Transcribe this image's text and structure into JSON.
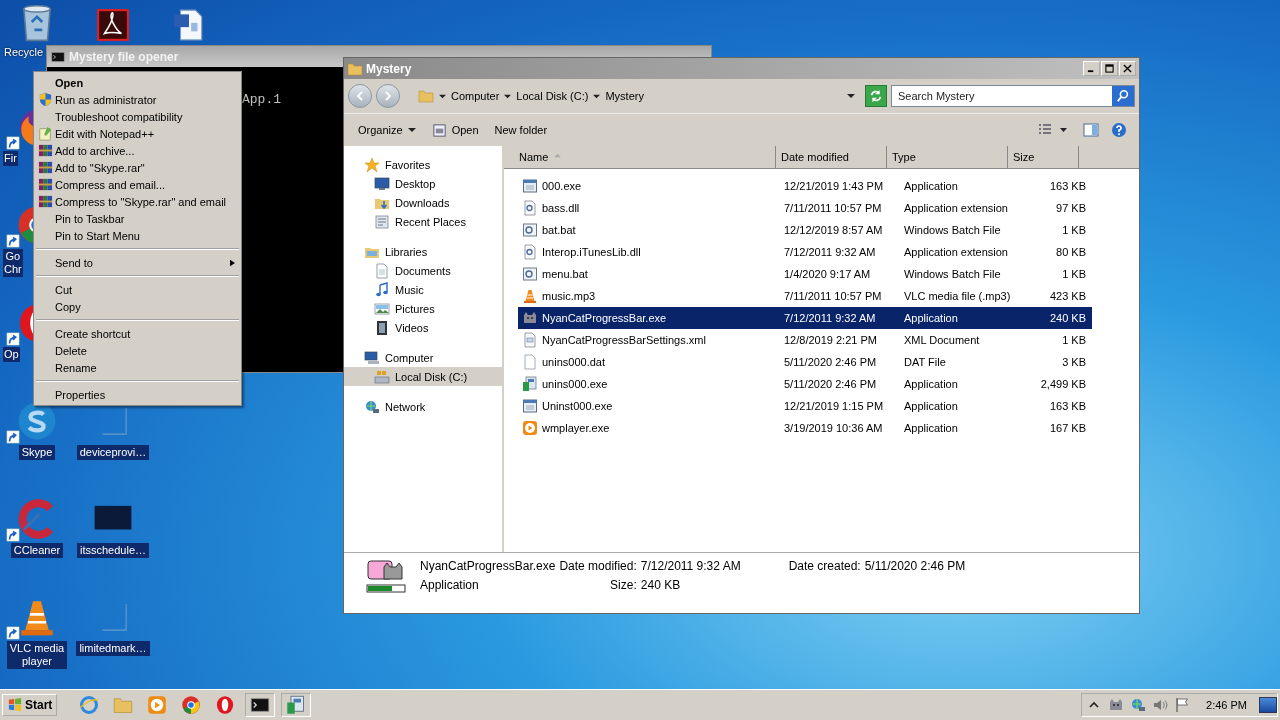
{
  "desktop_icons": [
    {
      "kind": "recycle",
      "shortcut": false,
      "label": [
        "Recycle"
      ]
    },
    {
      "kind": "acrobat",
      "shortcut": false
    },
    {
      "kind": "word",
      "shortcut": false
    },
    {
      "kind": "firefox",
      "shortcut": true,
      "label": [
        "Fir"
      ]
    },
    {
      "kind": "chrome",
      "shortcut": true,
      "label": [
        "Go",
        "Chr"
      ]
    },
    {
      "kind": "opera",
      "shortcut": true,
      "label": [
        "Op"
      ]
    },
    {
      "kind": "skype",
      "shortcut": true,
      "label": [
        "Skype"
      ]
    },
    {
      "kind": "blank",
      "shortcut": false,
      "label": [
        "deviceprovi…"
      ]
    },
    {
      "kind": "ccleaner",
      "shortcut": true,
      "label": [
        "CCleaner"
      ]
    },
    {
      "kind": "dark",
      "shortcut": false,
      "label": [
        "itsschedule…"
      ]
    },
    {
      "kind": "vlc",
      "shortcut": true,
      "label": [
        "VLC media",
        "player"
      ]
    },
    {
      "kind": "blank",
      "shortcut": false,
      "label": [
        "limitedmark…"
      ]
    }
  ],
  "console_window": {
    "title": "Mystery file opener",
    "lines": [
      "App.1"
    ]
  },
  "context_menu": [
    [
      {
        "label": "Open",
        "kind": "plain",
        "default": true,
        "submenu": false
      },
      {
        "label": "Run as administrator",
        "kind": "shield",
        "default": false,
        "submenu": false
      },
      {
        "label": "Troubleshoot compatibility",
        "kind": "plain",
        "default": false,
        "submenu": false
      },
      {
        "label": "Edit with Notepad++",
        "kind": "notepad",
        "default": false,
        "submenu": false
      },
      {
        "label": "Add to archive...",
        "kind": "rar",
        "default": false,
        "submenu": false
      },
      {
        "label": "Add to \"Skype.rar\"",
        "kind": "rar",
        "default": false,
        "submenu": false
      },
      {
        "label": "Compress and email...",
        "kind": "rar",
        "default": false,
        "submenu": false
      },
      {
        "label": "Compress to \"Skype.rar\" and email",
        "kind": "rar",
        "default": false,
        "submenu": false
      },
      {
        "label": "Pin to Taskbar",
        "kind": "plain",
        "default": false,
        "submenu": false
      },
      {
        "label": "Pin to Start Menu",
        "kind": "plain",
        "default": false,
        "submenu": false
      }
    ],
    [
      {
        "label": "Send to",
        "kind": "plain",
        "default": false,
        "submenu": true
      }
    ],
    [
      {
        "label": "Cut",
        "kind": "plain",
        "default": false,
        "submenu": false
      },
      {
        "label": "Copy",
        "kind": "plain",
        "default": false,
        "submenu": false
      }
    ],
    [
      {
        "label": "Create shortcut",
        "kind": "plain",
        "default": false,
        "submenu": false
      },
      {
        "label": "Delete",
        "kind": "plain",
        "default": false,
        "submenu": false
      },
      {
        "label": "Rename",
        "kind": "plain",
        "default": false,
        "submenu": false
      }
    ],
    [
      {
        "label": "Properties",
        "kind": "plain",
        "default": false,
        "submenu": false
      }
    ]
  ],
  "explorer": {
    "title": "Mystery",
    "breadcrumb": [
      "Computer",
      "Local Disk (C:)",
      "Mystery"
    ],
    "search": {
      "placeholder": "Search Mystery"
    },
    "toolbar": [
      {
        "label": "Organize",
        "kind": "menu"
      },
      {
        "label": "Open",
        "kind": "open"
      },
      {
        "label": "New folder",
        "kind": "plain"
      }
    ],
    "nav": [
      {
        "label": "Favorites",
        "kind": "star",
        "selected": false,
        "children": [
          {
            "label": "Desktop",
            "kind": "desktop",
            "selected": false
          },
          {
            "label": "Downloads",
            "kind": "downloads",
            "selected": false
          },
          {
            "label": "Recent Places",
            "kind": "recent",
            "selected": false
          }
        ]
      },
      {
        "label": "Libraries",
        "kind": "libraries",
        "selected": false,
        "children": [
          {
            "label": "Documents",
            "kind": "documents",
            "selected": false
          },
          {
            "label": "Music",
            "kind": "music",
            "selected": false
          },
          {
            "label": "Pictures",
            "kind": "pictures",
            "selected": false
          },
          {
            "label": "Videos",
            "kind": "videos",
            "selected": false
          }
        ]
      },
      {
        "label": "Computer",
        "kind": "computer",
        "selected": false,
        "children": [
          {
            "label": "Local Disk (C:)",
            "kind": "disk",
            "selected": true
          }
        ]
      },
      {
        "label": "Network",
        "kind": "network",
        "selected": false
      }
    ],
    "columns": [
      {
        "label": "Name",
        "sorted": true
      },
      {
        "label": "Date modified",
        "sorted": false
      },
      {
        "label": "Type",
        "sorted": false
      },
      {
        "label": "Size",
        "sorted": false
      }
    ],
    "files": [
      {
        "name": "000.exe",
        "kind": "app",
        "date": "12/21/2019 1:43 PM",
        "type": "Application",
        "size": "163 KB",
        "selected": false
      },
      {
        "name": "bass.dll",
        "kind": "dll",
        "date": "7/11/2011 10:57 PM",
        "type": "Application extension",
        "size": "97 KB",
        "selected": false
      },
      {
        "name": "bat.bat",
        "kind": "bat",
        "date": "12/12/2019 8:57 AM",
        "type": "Windows Batch File",
        "size": "1 KB",
        "selected": false
      },
      {
        "name": "Interop.iTunesLib.dll",
        "kind": "dll",
        "date": "7/12/2011 9:32 AM",
        "type": "Application extension",
        "size": "80 KB",
        "selected": false
      },
      {
        "name": "menu.bat",
        "kind": "bat",
        "date": "1/4/2020 9:17 AM",
        "type": "Windows Batch File",
        "size": "1 KB",
        "selected": false
      },
      {
        "name": "music.mp3",
        "kind": "vlc",
        "date": "7/11/2011 10:57 PM",
        "type": "VLC media file (.mp3)",
        "size": "423 KB",
        "selected": false
      },
      {
        "name": "NyanCatProgressBar.exe",
        "kind": "cat",
        "date": "7/12/2011 9:32 AM",
        "type": "Application",
        "size": "240 KB",
        "selected": true
      },
      {
        "name": "NyanCatProgressBarSettings.xml",
        "kind": "xml",
        "date": "12/8/2019 2:21 PM",
        "type": "XML Document",
        "size": "1 KB",
        "selected": false
      },
      {
        "name": "unins000.dat",
        "kind": "doc",
        "date": "5/11/2020 2:46 PM",
        "type": "DAT File",
        "size": "3 KB",
        "selected": false
      },
      {
        "name": "unins000.exe",
        "kind": "installer",
        "date": "5/11/2020 2:46 PM",
        "type": "Application",
        "size": "2,499 KB",
        "selected": false
      },
      {
        "name": "Uninst000.exe",
        "kind": "app",
        "date": "12/21/2019 1:15 PM",
        "type": "Application",
        "size": "163 KB",
        "selected": false
      },
      {
        "name": "wmplayer.exe",
        "kind": "wmp",
        "date": "3/19/2019 10:36 AM",
        "type": "Application",
        "size": "167 KB",
        "selected": false
      }
    ],
    "details": {
      "name": "NyanCatProgressBar.exe",
      "type": "Application",
      "fields": [
        {
          "label": "Date modified:",
          "value": "7/12/2011 9:32 AM"
        },
        {
          "label": "Date created:",
          "value": "5/11/2020 2:46 PM"
        },
        {
          "label": "Size:",
          "value": "240 KB"
        }
      ]
    }
  },
  "taskbar": {
    "start": "Start",
    "time": "2:46 PM"
  }
}
